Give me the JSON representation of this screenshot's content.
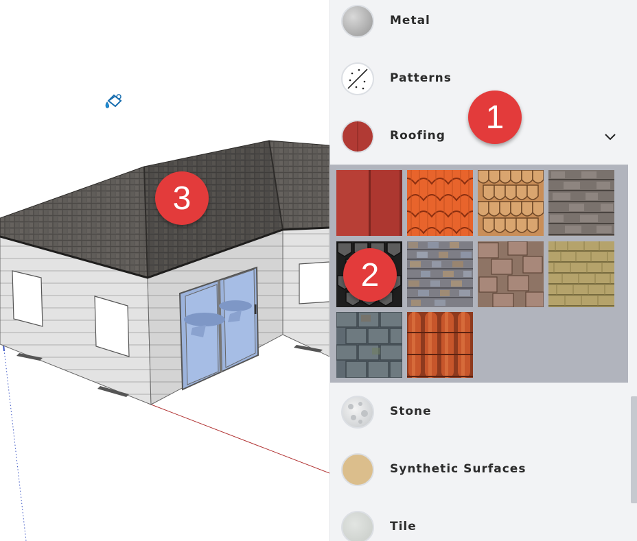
{
  "materials_panel": {
    "categories": [
      {
        "label": "Metal",
        "icon": "metal-swatch"
      },
      {
        "label": "Patterns",
        "icon": "patterns-swatch"
      },
      {
        "label": "Roofing",
        "icon": "roofing-swatch",
        "expanded": true
      },
      {
        "label": "Stone",
        "icon": "stone-swatch"
      },
      {
        "label": "Synthetic Surfaces",
        "icon": "synthetic-swatch"
      },
      {
        "label": "Tile",
        "icon": "tile-swatch"
      }
    ],
    "roofing_swatches": [
      {
        "name": "Metal Standing Seam Red"
      },
      {
        "name": "Roofing Scalloped Orange"
      },
      {
        "name": "Roofing Scalloped Tan"
      },
      {
        "name": "Roofing Shingles Gray"
      },
      {
        "name": "Roofing Slate Dark"
      },
      {
        "name": "Roofing Shingles Multi"
      },
      {
        "name": "Roofing Shingles Brown"
      },
      {
        "name": "Roofing Shakes Tan"
      },
      {
        "name": "Roofing Slate Blue Gray"
      },
      {
        "name": "Roofing Spanish Tile"
      }
    ],
    "colors": {
      "panel_bg": "#f2f3f5",
      "grid_bg": "#b1b4bd",
      "callout": "#e33b3b"
    }
  },
  "callouts": [
    {
      "number": "1"
    },
    {
      "number": "2"
    },
    {
      "number": "3"
    }
  ],
  "viewport": {
    "cursor_icon": "paint-bucket-icon",
    "model": "house-with-roof"
  }
}
